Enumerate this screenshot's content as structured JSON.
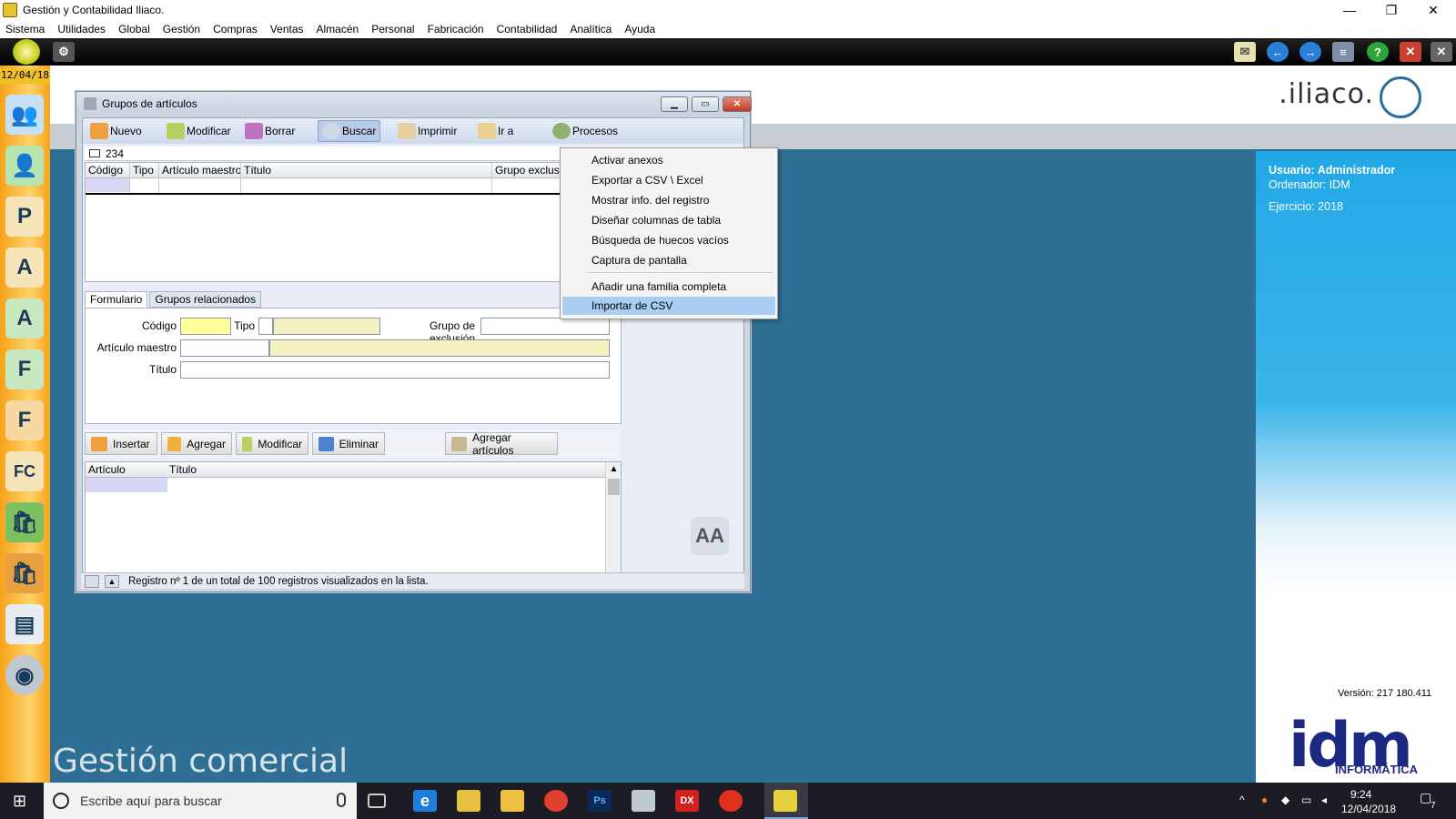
{
  "app": {
    "title": "Gestión y Contabilidad Iliaco.",
    "window_controls": [
      "—",
      "❐",
      "✕"
    ]
  },
  "menubar": [
    "Sistema",
    "Utilidades",
    "Global",
    "Gestión",
    "Compras",
    "Ventas",
    "Almacén",
    "Personal",
    "Fabricación",
    "Contabilidad",
    "Analítica",
    "Ayuda"
  ],
  "sidebar": {
    "date": "12/04/18",
    "icons": [
      "users-icon",
      "user-icon",
      "user-p-icon",
      "user-a-icon",
      "letter-a-icon",
      "letter-f-icon",
      "letter-f-icon",
      "letter-fc-icon",
      "bag-green-icon",
      "bag-orange-icon",
      "ledger-icon",
      "cd-icon"
    ],
    "letters": [
      "",
      "",
      "P",
      "A",
      "A",
      "F",
      "F",
      "FC",
      "",
      "",
      "",
      ""
    ]
  },
  "header": {
    "brand": ".iliaco.",
    "module_label": "Gestión comercial"
  },
  "right_panel": {
    "usuario": "Usuario: Administrador",
    "ordenador": "Ordenador: IDM",
    "ejercicio": "Ejercicio: 2018",
    "version": "Versión: 217 180.411",
    "logo": "idm",
    "logo_sub": "INFORMÁTICA"
  },
  "window": {
    "title": "Grupos de artículos",
    "toolbar": [
      "Nuevo",
      "Modificar",
      "Borrar",
      "Buscar",
      "Imprimir",
      "Ir a",
      "Procesos"
    ],
    "search_value": "234",
    "grid_headers": [
      "Código",
      "Tipo",
      "Artículo maestro",
      "Título",
      "Grupo exclusi"
    ],
    "tabs": [
      "Formulario",
      "Grupos relacionados"
    ],
    "form": {
      "codigo_label": "Código",
      "tipo_label": "Tipo",
      "grupo_exclusion_label": "Grupo de exclusión",
      "articulo_maestro_label": "Artículo maestro",
      "titulo_label": "Título"
    },
    "action_buttons": [
      "Insertar",
      "Agregar",
      "Modificar",
      "Eliminar",
      "Agregar artículos"
    ],
    "grid2_headers": [
      "Artículo",
      "Título"
    ],
    "status_text": "Registro nº 1 de un total de 100 registros visualizados en la lista."
  },
  "context_menu": {
    "items": [
      "Activar anexos",
      "Exportar a CSV \\ Excel",
      "Mostrar info. del registro",
      "Diseñar columnas de tabla",
      "Búsqueda de huecos vacíos",
      "Captura de pantalla",
      "Añadir una familia completa",
      "Importar de CSV"
    ],
    "highlighted": "Importar de CSV"
  },
  "taskbar": {
    "search_placeholder": "Escribe aquí para buscar",
    "time": "9:24",
    "date": "12/04/2018",
    "notifications": "7",
    "apps": [
      "task-view-icon",
      "edge-icon",
      "mail-icon",
      "explorer-icon",
      "chrome-icon",
      "photoshop-icon",
      "iliaco-icon",
      "dx-icon",
      "app-red-icon",
      "iliaco-active-icon"
    ],
    "app_labels": [
      "",
      "e",
      "",
      "",
      "",
      "Ps",
      "",
      "DX",
      "",
      ""
    ]
  },
  "colors": {
    "accent_blue": "#22a8e6",
    "sidebar_orange": "#f7a21a",
    "idm_navy": "#1b2a80",
    "menu_highlight": "#a9cdf3"
  }
}
